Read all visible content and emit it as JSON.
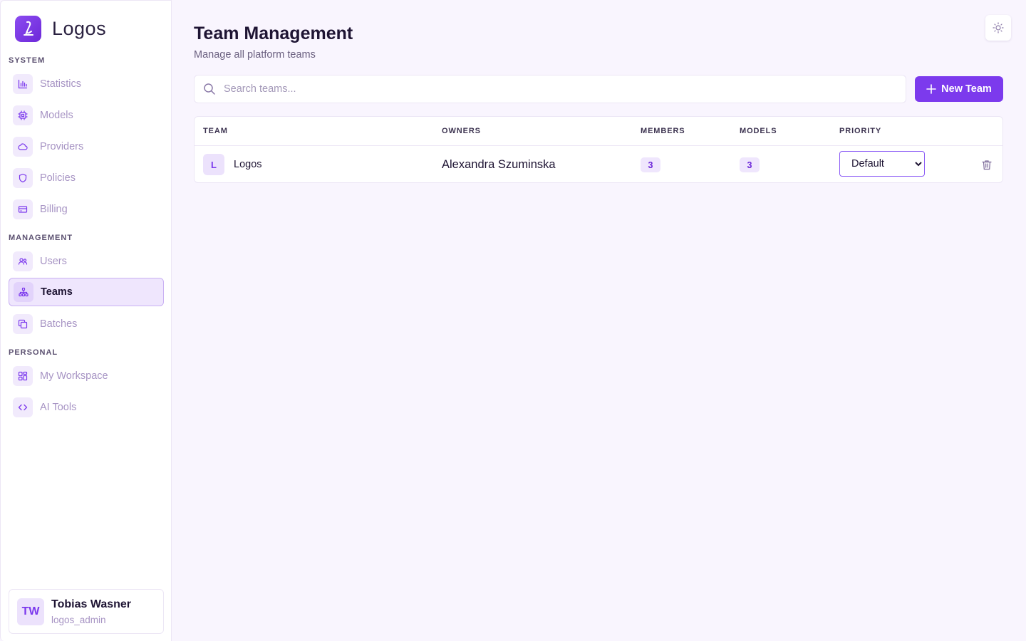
{
  "brand": {
    "name": "Logos"
  },
  "sidebar": {
    "sections": [
      {
        "label": "SYSTEM",
        "items": [
          {
            "label": "Statistics",
            "icon": "bar-chart-icon",
            "active": false
          },
          {
            "label": "Models",
            "icon": "cpu-chip-icon",
            "active": false
          },
          {
            "label": "Providers",
            "icon": "cloud-icon",
            "active": false
          },
          {
            "label": "Policies",
            "icon": "shield-icon",
            "active": false
          },
          {
            "label": "Billing",
            "icon": "credit-card-icon",
            "active": false
          }
        ]
      },
      {
        "label": "MANAGEMENT",
        "items": [
          {
            "label": "Users",
            "icon": "users-icon",
            "active": false
          },
          {
            "label": "Teams",
            "icon": "org-chart-icon",
            "active": true
          },
          {
            "label": "Batches",
            "icon": "copy-icon",
            "active": false
          }
        ]
      },
      {
        "label": "PERSONAL",
        "items": [
          {
            "label": "My Workspace",
            "icon": "grid-icon",
            "active": false
          },
          {
            "label": "AI Tools",
            "icon": "code-icon",
            "active": false
          }
        ]
      }
    ]
  },
  "user": {
    "initials": "TW",
    "name": "Tobias Wasner",
    "handle": "logos_admin"
  },
  "page": {
    "title": "Team Management",
    "subtitle": "Manage all platform teams"
  },
  "search": {
    "placeholder": "Search teams...",
    "value": ""
  },
  "actions": {
    "new_team_label": "New Team"
  },
  "table": {
    "columns": [
      "TEAM",
      "OWNERS",
      "MEMBERS",
      "MODELS",
      "PRIORITY"
    ],
    "rows": [
      {
        "initial": "L",
        "team": "Logos",
        "owners": "Alexandra Szuminska",
        "members": "3",
        "models": "3",
        "priority": "Default"
      }
    ]
  },
  "colors": {
    "accent": "#7c3aed",
    "background": "#f9f5fe",
    "active_bg": "#efe6fd"
  }
}
